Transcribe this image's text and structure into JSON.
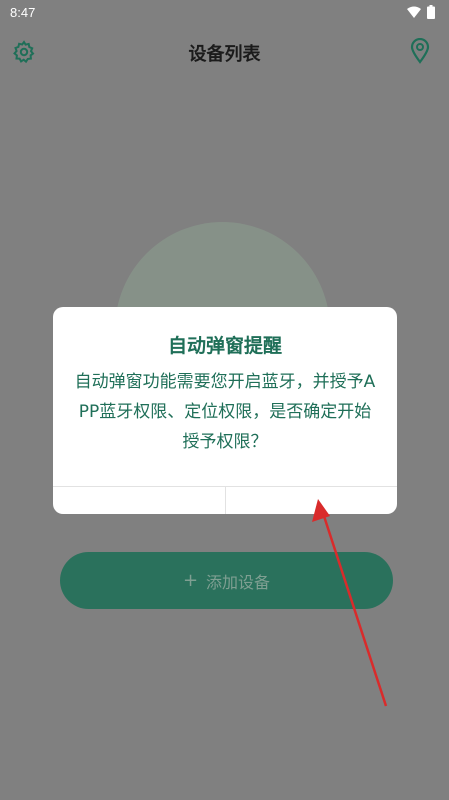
{
  "status_bar": {
    "time": "8:47"
  },
  "app_bar": {
    "title": "设备列表"
  },
  "main": {
    "add_device_label": "添加设备"
  },
  "dialog": {
    "title": "自动弹窗提醒",
    "message": "自动弹窗功能需要您开启蓝牙，并授予APP蓝牙权限、定位权限，是否确定开始授予权限？",
    "cancel_label": "",
    "confirm_label": ""
  },
  "colors": {
    "accent": "#1f6f58",
    "overlay": "#808080",
    "annotation_arrow": "#d92b2b"
  }
}
